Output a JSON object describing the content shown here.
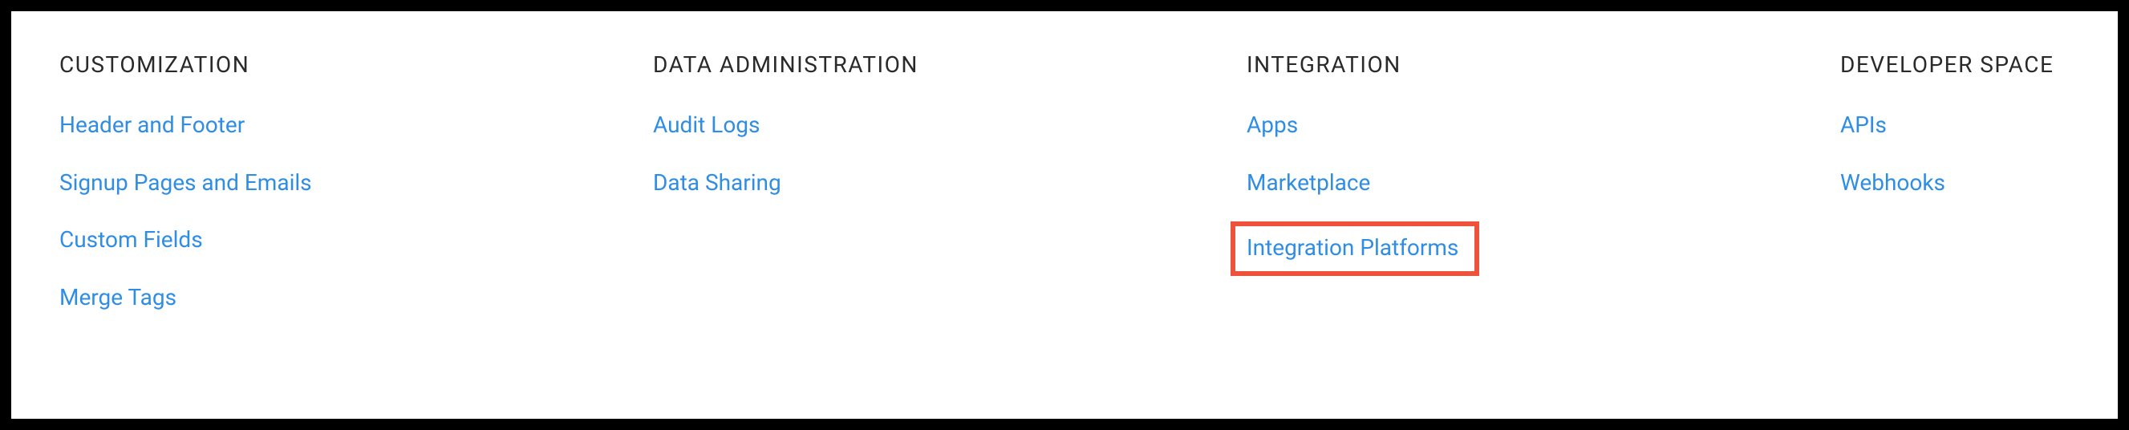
{
  "columns": [
    {
      "heading": "CUSTOMIZATION",
      "links": [
        {
          "label": "Header and Footer",
          "highlighted": false
        },
        {
          "label": "Signup Pages and Emails",
          "highlighted": false
        },
        {
          "label": "Custom Fields",
          "highlighted": false
        },
        {
          "label": "Merge Tags",
          "highlighted": false
        }
      ]
    },
    {
      "heading": "DATA ADMINISTRATION",
      "links": [
        {
          "label": "Audit Logs",
          "highlighted": false
        },
        {
          "label": "Data Sharing",
          "highlighted": false
        }
      ]
    },
    {
      "heading": "INTEGRATION",
      "links": [
        {
          "label": "Apps",
          "highlighted": false
        },
        {
          "label": "Marketplace",
          "highlighted": false
        },
        {
          "label": "Integration Platforms",
          "highlighted": true
        }
      ]
    },
    {
      "heading": "DEVELOPER SPACE",
      "links": [
        {
          "label": "APIs",
          "highlighted": false
        },
        {
          "label": "Webhooks",
          "highlighted": false
        }
      ]
    }
  ]
}
